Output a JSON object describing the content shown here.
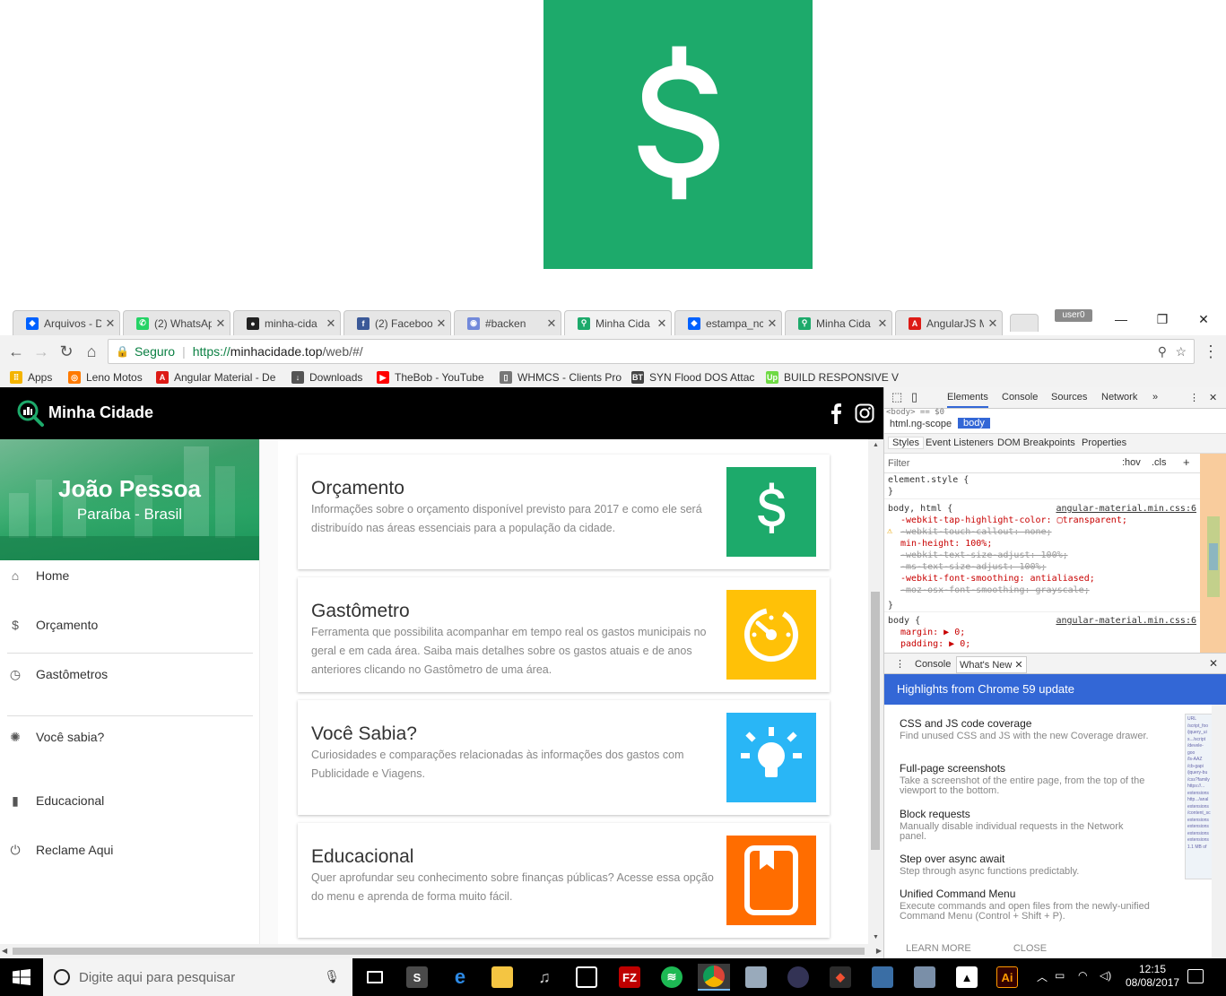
{
  "browser": {
    "tabs": [
      {
        "label": "Arquivos - D",
        "icon": "dropbox-icon",
        "color": "#0061ff"
      },
      {
        "label": "(2) WhatsAp",
        "icon": "whatsapp-icon",
        "color": "#25d366"
      },
      {
        "label": "minha-cida",
        "icon": "github-icon",
        "color": "#222222"
      },
      {
        "label": "(2) Faceboo",
        "icon": "facebook-icon",
        "color": "#3b5998"
      },
      {
        "label": "#backen",
        "icon": "discord-icon",
        "color": "#7289da"
      },
      {
        "label": "Minha Cida",
        "icon": "search-icon",
        "color": "#1daa6b",
        "active": true
      },
      {
        "label": "estampa_nc",
        "icon": "dropbox-icon",
        "color": "#0061ff"
      },
      {
        "label": "Minha Cida",
        "icon": "search-icon",
        "color": "#1daa6b"
      },
      {
        "label": "AngularJS M",
        "icon": "angular-icon",
        "color": "#dd1b16"
      }
    ],
    "user_badge": "user0",
    "window_controls": {
      "minimize": "—",
      "restore": "❐",
      "close": "✕"
    },
    "omnibox": {
      "secure_label": "Seguro",
      "url_scheme": "https://",
      "url_host": "minhacidade.top",
      "url_path": "/web/#/"
    },
    "bookmarks": [
      {
        "label": "Apps",
        "icon": "apps-icon",
        "color": "#f4b400"
      },
      {
        "label": "Leno Motos",
        "icon": "lenomotos-icon",
        "color": "#ff7a00"
      },
      {
        "label": "Angular Material - De",
        "icon": "angular-icon",
        "color": "#dd1b16"
      },
      {
        "label": "Downloads",
        "icon": "download-icon",
        "color": "#555555"
      },
      {
        "label": "TheBob - YouTube",
        "icon": "youtube-icon",
        "color": "#ff0000"
      },
      {
        "label": "WHMCS - Clients Pro",
        "icon": "page-icon",
        "color": "#777777"
      },
      {
        "label": "SYN Flood DOS Attac",
        "icon": "bt-icon",
        "color": "#444444"
      },
      {
        "label": "BUILD RESPONSIVE V",
        "icon": "upwork-icon",
        "color": "#6fda44"
      }
    ]
  },
  "app": {
    "title": "Minha Cidade",
    "city": {
      "name": "João Pessoa",
      "state": "Paraíba - Brasil"
    },
    "nav": [
      {
        "label": "Home",
        "icon": "home-icon"
      },
      {
        "label": "Orçamento",
        "icon": "dollar-icon"
      },
      {
        "label": "Gastômetros",
        "icon": "gauge-icon"
      },
      {
        "label": "Você sabia?",
        "icon": "lightbulb-icon"
      },
      {
        "label": "Educacional",
        "icon": "book-icon"
      },
      {
        "label": "Reclame Aqui",
        "icon": "power-icon"
      }
    ],
    "cards": [
      {
        "title": "Orçamento",
        "desc": "Informações sobre o orçamento disponível previsto para 2017 e como ele será distribuído nas áreas essenciais para a população da cidade.",
        "icon": "dollar-icon",
        "color": "#1daa6b"
      },
      {
        "title": "Gastômetro",
        "desc": "Ferramenta que possibilita acompanhar em tempo real os gastos municipais no geral e em cada área. Saiba mais detalhes sobre os gastos atuais e de anos anteriores clicando no Gastômetro de uma área.",
        "icon": "gauge-icon",
        "color": "#ffc107"
      },
      {
        "title": "Você Sabia?",
        "desc": "Curiosidades e comparações relacionadas às informações dos gastos com Publicidade e Viagens.",
        "icon": "lightbulb-icon",
        "color": "#29b6f6"
      },
      {
        "title": "Educacional",
        "desc": "Quer aprofundar seu conhecimento sobre finanças públicas? Acesse essa opção do menu e aprenda de forma muito fácil.",
        "icon": "book-icon",
        "color": "#ff6d00"
      }
    ]
  },
  "devtools": {
    "tabs": [
      "Elements",
      "Console",
      "Sources",
      "Network",
      "»"
    ],
    "selected_node": "<body> == $0",
    "breadcrumb": [
      "html.ng-scope",
      "body"
    ],
    "subtabs": [
      "Styles",
      "Event Listeners",
      "DOM Breakpoints",
      "Properties"
    ],
    "filter_placeholder": "Filter",
    "filter_hov": ":hov",
    "filter_cls": ".cls",
    "styles": {
      "element_style": "element.style {",
      "close_brace": "}",
      "rule1_selector": "body, html {",
      "rule1_source": "angular-material.min.css:6",
      "rule1_props": [
        {
          "text": "-webkit-tap-highlight-color: ▢transparent;",
          "struck": false
        },
        {
          "text": "-webkit-touch-callout: none;",
          "struck": true
        },
        {
          "text": "min-height: 100%;",
          "struck": false
        },
        {
          "text": "-webkit-text-size-adjust: 100%;",
          "struck": true
        },
        {
          "text": "-ms-text-size-adjust: 100%;",
          "struck": true
        },
        {
          "text": "-webkit-font-smoothing: antialiased;",
          "struck": false
        },
        {
          "text": "-moz-osx-font-smoothing: grayscale;",
          "struck": true
        }
      ],
      "rule2_selector": "body {",
      "rule2_source": "angular-material.min.css:6",
      "rule2_props": [
        "margin: ▶ 0;",
        "padding: ▶ 0;"
      ]
    },
    "drawer_tabs": [
      "Console",
      "What's New"
    ],
    "highlights_title": "Highlights from Chrome 59 update",
    "news": [
      {
        "title": "CSS and JS code coverage",
        "desc": "Find unused CSS and JS with the new Coverage drawer."
      },
      {
        "title": "Full-page screenshots",
        "desc": "Take a screenshot of the entire page, from the top of the viewport to the bottom."
      },
      {
        "title": "Block requests",
        "desc": "Manually disable individual requests in the Network panel."
      },
      {
        "title": "Step over async await",
        "desc": "Step through async functions predictably."
      },
      {
        "title": "Unified Command Menu",
        "desc": "Execute commands and open files from the newly-unified Command Menu (Control + Shift + P)."
      }
    ],
    "news_buttons": [
      "LEARN MORE",
      "CLOSE"
    ]
  },
  "taskbar": {
    "search_placeholder": "Digite aqui para pesquisar",
    "time": "12:15",
    "date": "08/08/2017"
  }
}
